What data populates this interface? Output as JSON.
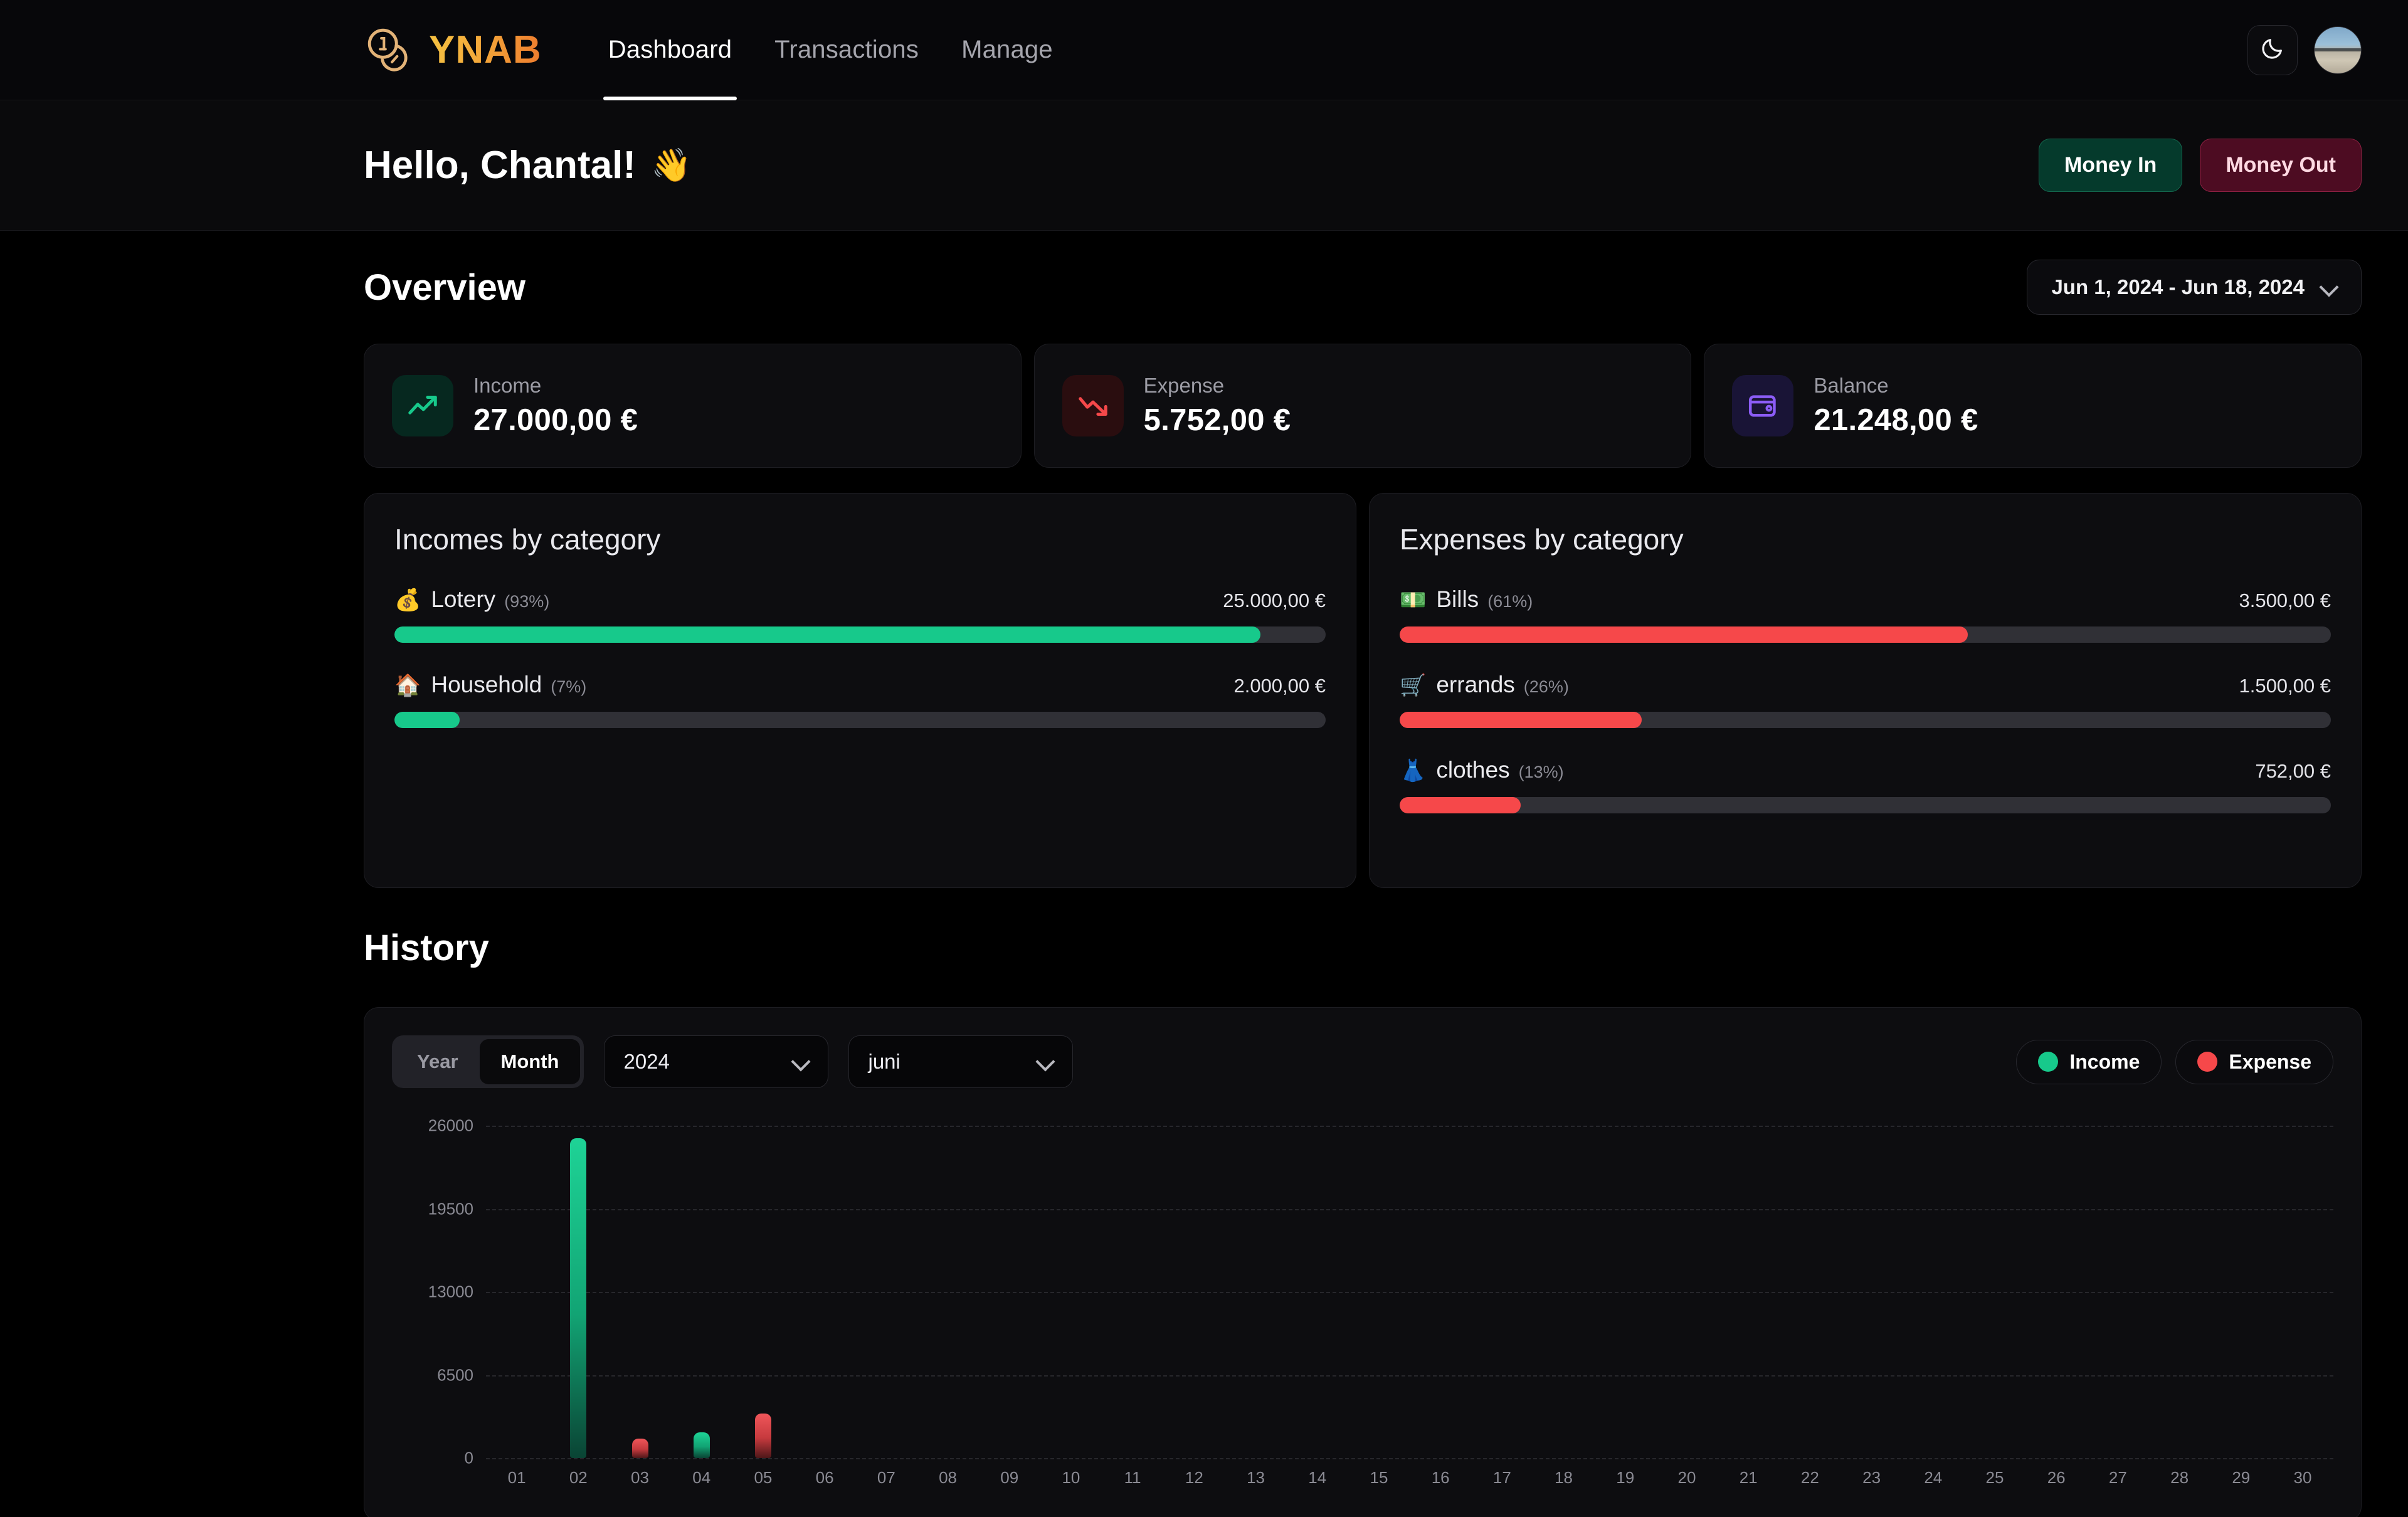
{
  "brand": {
    "name": "YNAB",
    "logo_icon": "two-coins-icon"
  },
  "nav": {
    "links": [
      {
        "label": "Dashboard",
        "active": true
      },
      {
        "label": "Transactions",
        "active": false
      },
      {
        "label": "Manage",
        "active": false
      }
    ],
    "theme_toggle_icon": "moon-icon",
    "avatar_name": "user-avatar"
  },
  "greeting": {
    "title": "Hello, Chantal!",
    "emoji": "👋",
    "money_in_label": "Money In",
    "money_out_label": "Money Out"
  },
  "overview": {
    "title": "Overview",
    "date_range": "Jun 1, 2024 - Jun 18, 2024",
    "stats": [
      {
        "label": "Income",
        "value": "27.000,00 €",
        "icon": "trending-up-icon",
        "color": "#17c98b"
      },
      {
        "label": "Expense",
        "value": "5.752,00 €",
        "icon": "trending-down-icon",
        "color": "#f6484a"
      },
      {
        "label": "Balance",
        "value": "21.248,00 €",
        "icon": "wallet-icon",
        "color": "#8b5cf6"
      }
    ]
  },
  "incomes_panel": {
    "title": "Incomes by category",
    "items": [
      {
        "emoji": "💰",
        "name": "Lotery",
        "percent": "(93%)",
        "amount": "25.000,00 €",
        "fill": 93
      },
      {
        "emoji": "🏠",
        "name": "Household",
        "percent": "(7%)",
        "amount": "2.000,00 €",
        "fill": 7
      }
    ]
  },
  "expenses_panel": {
    "title": "Expenses by category",
    "items": [
      {
        "emoji": "💵",
        "name": "Bills",
        "percent": "(61%)",
        "amount": "3.500,00 €",
        "fill": 61
      },
      {
        "emoji": "🛒",
        "name": "errands",
        "percent": "(26%)",
        "amount": "1.500,00 €",
        "fill": 26
      },
      {
        "emoji": "👗",
        "name": "clothes",
        "percent": "(13%)",
        "amount": "752,00 €",
        "fill": 13
      }
    ]
  },
  "history": {
    "title": "History",
    "toggle": {
      "year_label": "Year",
      "month_label": "Month",
      "active": "Month"
    },
    "year_select": "2024",
    "month_select": "juni",
    "legend": [
      {
        "label": "Income",
        "color": "#17c98b"
      },
      {
        "label": "Expense",
        "color": "#f6484a"
      }
    ]
  },
  "chart_data": {
    "type": "bar",
    "title": "History",
    "xlabel": "",
    "ylabel": "",
    "ylim": [
      0,
      26000
    ],
    "yticks": [
      0,
      6500,
      13000,
      19500,
      26000
    ],
    "grid": true,
    "legend_position": "top-right",
    "categories": [
      "01",
      "02",
      "03",
      "04",
      "05",
      "06",
      "07",
      "08",
      "09",
      "10",
      "11",
      "12",
      "13",
      "14",
      "15",
      "16",
      "17",
      "18",
      "19",
      "20",
      "21",
      "22",
      "23",
      "24",
      "25",
      "26",
      "27",
      "28",
      "29",
      "30"
    ],
    "series": [
      {
        "name": "Income",
        "color": "#17c98b",
        "values": [
          0,
          25000,
          0,
          2000,
          0,
          0,
          0,
          0,
          0,
          0,
          0,
          0,
          0,
          0,
          0,
          0,
          0,
          0,
          0,
          0,
          0,
          0,
          0,
          0,
          0,
          0,
          0,
          0,
          0,
          0
        ]
      },
      {
        "name": "Expense",
        "color": "#f6484a",
        "values": [
          0,
          0,
          1500,
          0,
          3500,
          0,
          0,
          0,
          0,
          0,
          0,
          0,
          0,
          0,
          0,
          0,
          0,
          0,
          0,
          0,
          0,
          0,
          0,
          0,
          0,
          0,
          0,
          0,
          0,
          0
        ]
      }
    ]
  }
}
